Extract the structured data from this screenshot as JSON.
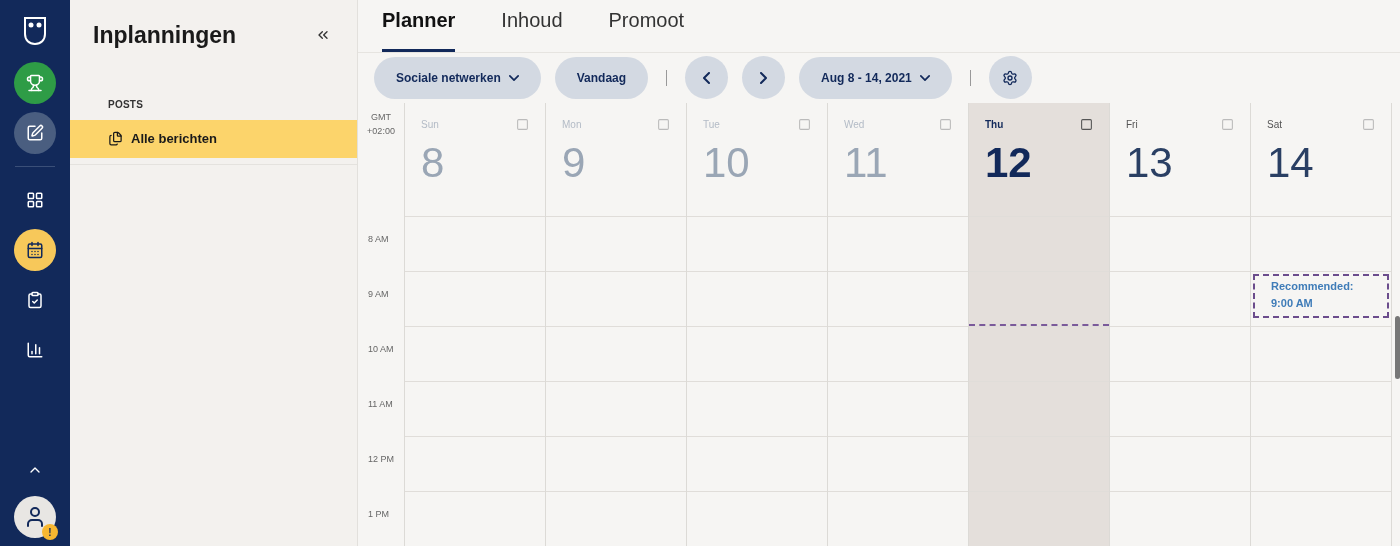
{
  "rail": {
    "actions": [
      {
        "kind": "trophy"
      },
      {
        "kind": "compose"
      }
    ],
    "items": [
      {
        "kind": "dashboard",
        "selected": false
      },
      {
        "kind": "calendar",
        "selected": true
      },
      {
        "kind": "clipboard",
        "selected": false
      },
      {
        "kind": "chart",
        "selected": false
      }
    ],
    "footer": {
      "badge": "!"
    }
  },
  "panel": {
    "title": "Inplanningen",
    "section": "POSTS",
    "items": [
      {
        "label": "Alle berichten",
        "selected": true
      }
    ]
  },
  "tabs": [
    {
      "label": "Planner",
      "selected": true
    },
    {
      "label": "Inhoud",
      "selected": false
    },
    {
      "label": "Promoot",
      "selected": false
    }
  ],
  "toolbar": {
    "network_filter": "Sociale netwerken",
    "today_button": "Vandaag",
    "date_range": "Aug 8 - 14, 2021"
  },
  "calendar": {
    "timezone": "GMT +02:00",
    "days": [
      {
        "name": "Sun",
        "date": "8",
        "past": true,
        "selected": false
      },
      {
        "name": "Mon",
        "date": "9",
        "past": true,
        "selected": false
      },
      {
        "name": "Tue",
        "date": "10",
        "past": true,
        "selected": false
      },
      {
        "name": "Wed",
        "date": "11",
        "past": true,
        "selected": false
      },
      {
        "name": "Thu",
        "date": "12",
        "past": false,
        "selected": true
      },
      {
        "name": "Fri",
        "date": "13",
        "past": false,
        "selected": false
      },
      {
        "name": "Sat",
        "date": "14",
        "past": false,
        "selected": false,
        "recommendation": "Recommended: 9:00 AM"
      }
    ],
    "hours": [
      "8 AM",
      "9 AM",
      "10 AM",
      "11 AM",
      "12 PM",
      "1 PM"
    ]
  }
}
